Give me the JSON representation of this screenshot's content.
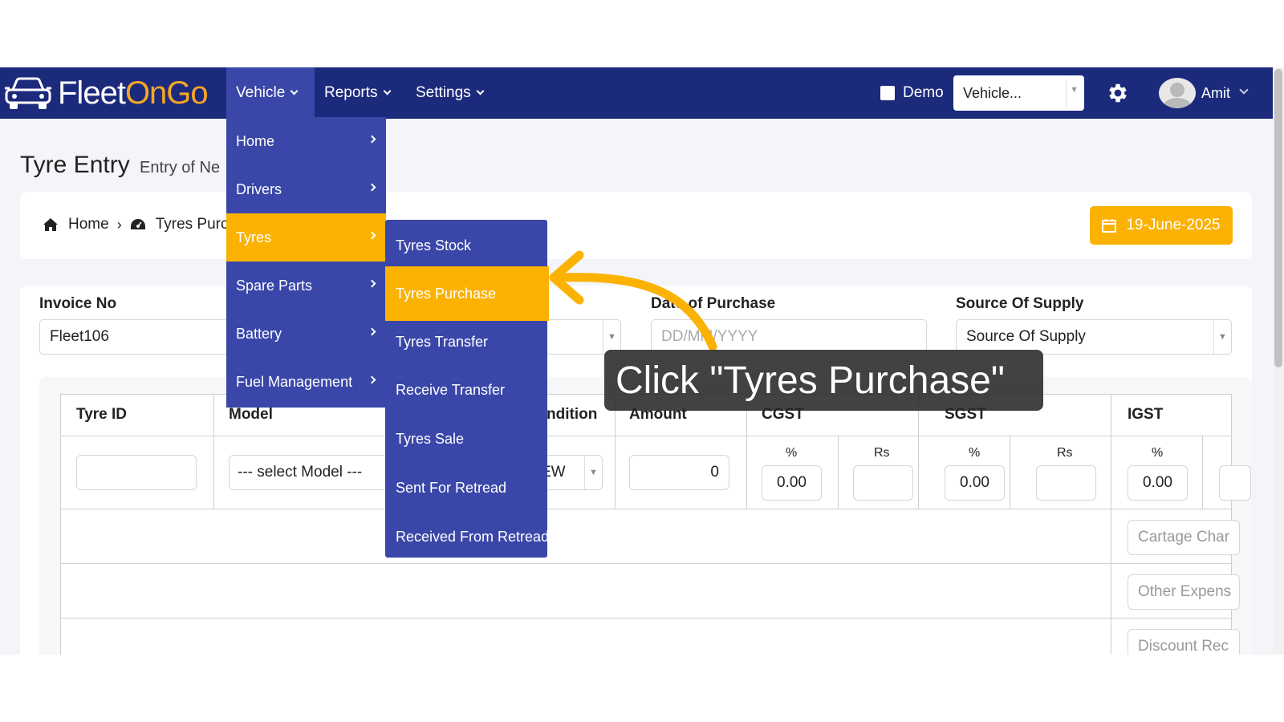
{
  "app": {
    "logo_text_white": "Fleet",
    "logo_text_orange": "OnGo"
  },
  "nav": {
    "vehicle": "Vehicle",
    "reports": "Reports",
    "settings": "Settings",
    "demo": "Demo",
    "vehicle_select": "Vehicle...",
    "user": "Amit"
  },
  "page": {
    "title": "Tyre Entry",
    "subtitle": "Entry of Ne",
    "breadcrumb_home": "Home",
    "breadcrumb_current": "Tyres Purc",
    "date": "19-June-2025"
  },
  "form": {
    "invoice_label": "Invoice No",
    "invoice_value": "Fleet106",
    "date_label": "Date of Purchase",
    "date_placeholder": "DD/MM/YYYY",
    "source_label": "Source Of Supply",
    "source_value": "Source Of Supply"
  },
  "table": {
    "headers": {
      "tyre_id": "Tyre ID",
      "model": "Model",
      "condition": "ndition",
      "amount": "Amount",
      "cgst": "CGST",
      "sgst": "SGST",
      "igst": "IGST"
    },
    "percent": "%",
    "rs": "Rs",
    "model_placeholder": "--- select Model ---",
    "condition_value": "EW",
    "amount_value": "0",
    "cgst_pct": "0.00",
    "sgst_pct": "0.00",
    "igst_pct": "0.00",
    "cartage": "Cartage Char",
    "other_expense": "Other Expens",
    "discount": "Discount Rec"
  },
  "menu": {
    "items": [
      "Home",
      "Drivers",
      "Tyres",
      "Spare Parts",
      "Battery",
      "Fuel Management"
    ],
    "active": "Tyres"
  },
  "submenu": {
    "items": [
      "Tyres Stock",
      "Tyres Purchase",
      "Tyres Transfer",
      "Receive Transfer",
      "Tyres Sale",
      "Sent For Retread",
      "Received From Retread"
    ],
    "active": "Tyres Purchase"
  },
  "annotation": {
    "text": "Click \"Tyres Purchase\""
  },
  "colors": {
    "nav_bg": "#1c2a7c",
    "menu_bg": "#3a47a8",
    "accent": "#fbb203"
  }
}
